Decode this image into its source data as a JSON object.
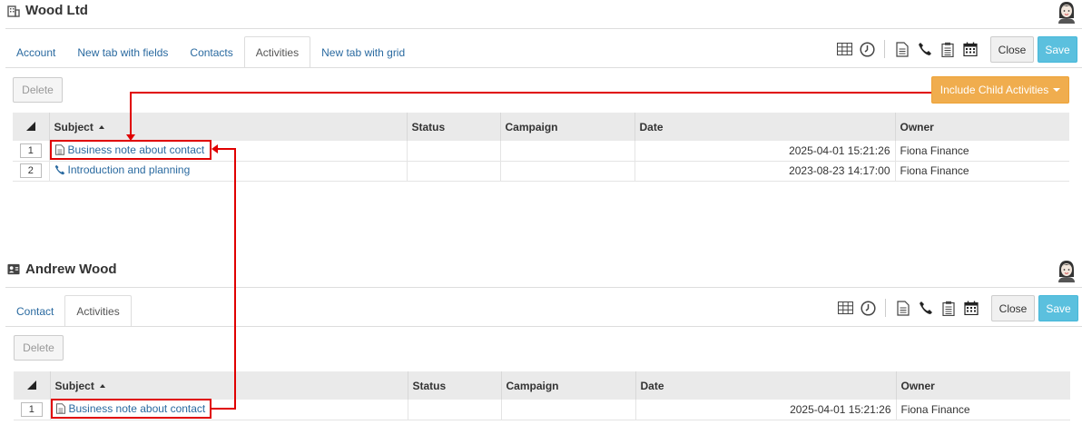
{
  "panels": [
    {
      "title": "Wood Ltd",
      "title_icon": "building-icon",
      "tabs": [
        "Account",
        "New tab with fields",
        "Contacts",
        "Activities",
        "New tab with grid"
      ],
      "active_tab": "Activities",
      "toolbar": {
        "close_label": "Close",
        "save_label": "Save",
        "delete_label": "Delete",
        "include_label": "Include Child Activities"
      },
      "grid": {
        "columns": {
          "subject": "Subject",
          "status": "Status",
          "campaign": "Campaign",
          "date": "Date",
          "owner": "Owner"
        },
        "rows": [
          {
            "num": "1",
            "icon": "note-icon",
            "subject": "Business note about contact",
            "status": "",
            "campaign": "",
            "date": "2025-04-01 15:21:26",
            "owner": "Fiona Finance"
          },
          {
            "num": "2",
            "icon": "phone-icon",
            "subject": "Introduction and planning",
            "status": "",
            "campaign": "",
            "date": "2023-08-23 14:17:00",
            "owner": "Fiona Finance"
          }
        ]
      }
    },
    {
      "title": "Andrew Wood",
      "title_icon": "contact-card-icon",
      "tabs": [
        "Contact",
        "Activities"
      ],
      "active_tab": "Activities",
      "toolbar": {
        "close_label": "Close",
        "save_label": "Save",
        "delete_label": "Delete"
      },
      "grid": {
        "columns": {
          "subject": "Subject",
          "status": "Status",
          "campaign": "Campaign",
          "date": "Date",
          "owner": "Owner"
        },
        "rows": [
          {
            "num": "1",
            "icon": "note-icon",
            "subject": "Business note about contact",
            "status": "",
            "campaign": "",
            "date": "2025-04-01 15:21:26",
            "owner": "Fiona Finance"
          }
        ]
      }
    }
  ],
  "toolbar_icons": [
    "grid-icon",
    "clock-icon",
    "note-icon",
    "phone-icon",
    "clipboard-icon",
    "calendar-icon"
  ],
  "colors": {
    "link": "#2a6aa0",
    "save": "#5bc0de",
    "include": "#f0ad4e",
    "annotation": "#e00000"
  }
}
